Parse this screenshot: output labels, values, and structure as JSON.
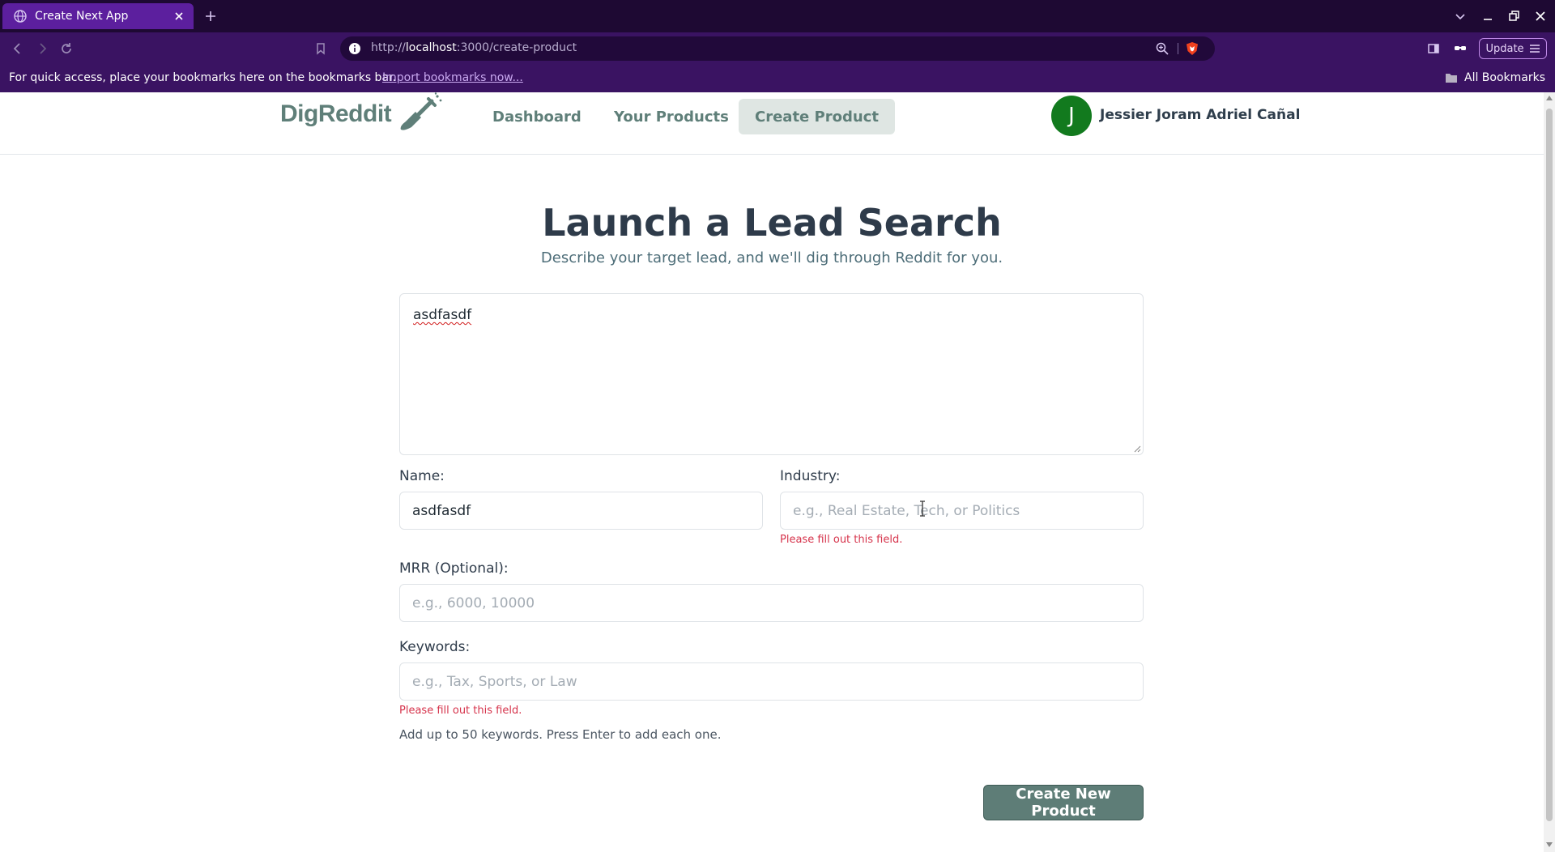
{
  "browser": {
    "tab_title": "Create Next App",
    "url_prefix": "http://",
    "url_host": "localhost",
    "url_rest": ":3000/create-product",
    "update_label": "Update",
    "bookmarks_text": "For quick access, place your bookmarks here on the bookmarks bar.",
    "bookmarks_link": "Import bookmarks now...",
    "all_bookmarks": "All Bookmarks"
  },
  "header": {
    "logo_text": "DigReddit",
    "nav": [
      {
        "label": "Dashboard"
      },
      {
        "label": "Your Products"
      },
      {
        "label": "Create Product"
      }
    ],
    "avatar_letter": "J",
    "user_name": "Jessier Joram Adriel Cañal",
    "avatar_color": "#127a1e"
  },
  "page": {
    "title": "Launch a Lead Search",
    "subtitle": "Describe your target lead, and we'll dig through Reddit for you.",
    "description_value": "asdfasdf"
  },
  "form": {
    "name_label": "Name:",
    "name_value": "asdfasdf",
    "industry_label": "Industry:",
    "industry_placeholder": "e.g., Real Estate, Tech, or Politics",
    "industry_error": "Please fill out this field.",
    "mrr_label": "MRR (Optional):",
    "mrr_placeholder": "e.g., 6000, 10000",
    "keywords_label": "Keywords:",
    "keywords_placeholder": "e.g., Tax, Sports, or Law",
    "keywords_error": "Please fill out this field.",
    "keywords_hint": "Add up to 50 keywords. Press Enter to add each one.",
    "submit_label": "Create New Product"
  },
  "colors": {
    "accent": "#5e7d77",
    "error": "#d6334b",
    "browser_tab": "#5c1f9e",
    "browser_bg": "#3a1362"
  },
  "icons": [
    "globe-icon",
    "tab-close-icon",
    "new-tab-icon",
    "back-icon",
    "forward-icon",
    "reload-icon",
    "bookmark-icon",
    "site-info-icon",
    "zoom-icon",
    "brave-shield-icon",
    "sidebar-icon",
    "wallet-icon",
    "menu-icon",
    "folder-icon",
    "shovel-icon"
  ]
}
